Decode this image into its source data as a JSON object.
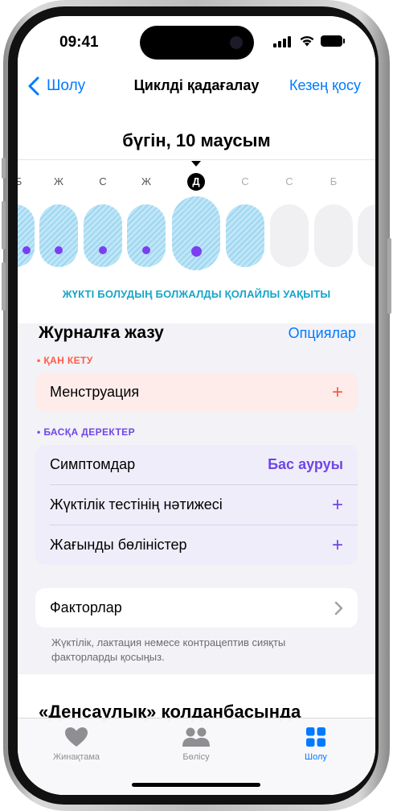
{
  "status": {
    "time": "09:41"
  },
  "nav": {
    "back_label": "Шолу",
    "title": "Циклді қадағалау",
    "action_label": "Кезең қосу"
  },
  "calendar": {
    "date_title": "бүгін, 10 маусым",
    "days": [
      {
        "letter": "Б",
        "state": "past"
      },
      {
        "letter": "Ж",
        "state": "past"
      },
      {
        "letter": "С",
        "state": "past"
      },
      {
        "letter": "Ж",
        "state": "past"
      },
      {
        "letter": "Д",
        "state": "today"
      },
      {
        "letter": "С",
        "state": "future"
      },
      {
        "letter": "С",
        "state": "future"
      },
      {
        "letter": "Б",
        "state": "future"
      }
    ],
    "fertile_label": "ЖҮКТІ БОЛУДЫҢ БОЛЖАЛДЫ ҚОЛАЙЛЫ УАҚЫТЫ"
  },
  "journal": {
    "title": "Журналға жазу",
    "options_label": "Опциялар",
    "bleeding": {
      "tag": "• ҚАН КЕТУ",
      "row_label": "Менструация",
      "row_action": "+"
    },
    "other": {
      "tag": "• БАСҚА ДЕРЕКТЕР",
      "rows": [
        {
          "label": "Симптомдар",
          "value": "Бас ауруы"
        },
        {
          "label": "Жүктілік тестінің нәтижесі",
          "value": "+"
        },
        {
          "label": "Жағынды бөліністер",
          "value": "+"
        }
      ]
    },
    "factors": {
      "label": "Факторлар",
      "note": "Жүктілік, лактация немесе контрацептив сияқты факторларды қосыңыз."
    }
  },
  "health_section_title": "«Денсаулық» қолданбасында",
  "tabbar": {
    "items": [
      {
        "label": "Жинақтама",
        "icon": "heart-icon"
      },
      {
        "label": "Бөлісу",
        "icon": "people-icon"
      },
      {
        "label": "Шолу",
        "icon": "grid-icon"
      }
    ]
  },
  "colors": {
    "accent": "#007aff",
    "bleeding_tint": "#ff5a45",
    "bleeding_card": "#fdecea",
    "other_tint": "#6e46e6",
    "other_card": "#efedf9",
    "fertile_text": "#17a5c9",
    "period_dot": "#7b3ff2"
  }
}
